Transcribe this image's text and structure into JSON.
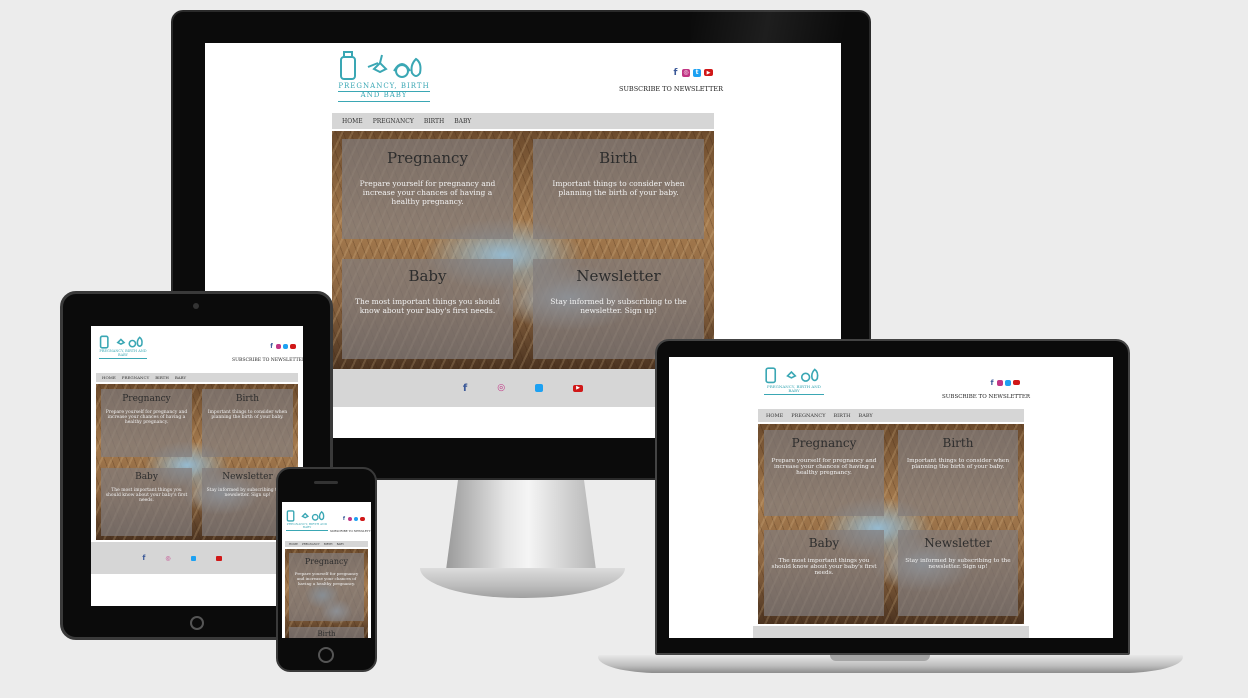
{
  "site": {
    "brand": "Pregnancy, Birth and Baby",
    "brand_line1": "Pregnancy, Birth",
    "brand_line2": "and Baby",
    "subscribe": "SUBSCRIBE TO NEWSLETTER",
    "nav": [
      "HOME",
      "PREGNANCY",
      "BIRTH",
      "BABY"
    ],
    "socials": [
      {
        "name": "facebook",
        "glyph": "f",
        "color": "#3b5998"
      },
      {
        "name": "instagram",
        "glyph": "◎",
        "color": "#c13584"
      },
      {
        "name": "twitter",
        "glyph": "t",
        "color": "#1da1f2"
      },
      {
        "name": "youtube",
        "glyph": "▶",
        "color": "#d01818"
      }
    ],
    "cards": [
      {
        "title": "Pregnancy",
        "desc": "Prepare yourself for pregnancy and increase your chances of having a healthy pregnancy."
      },
      {
        "title": "Birth",
        "desc": "Important things to consider when planning the birth of your baby."
      },
      {
        "title": "Baby",
        "desc": "The most important things you should know about your baby's first needs."
      },
      {
        "title": "Newsletter",
        "desc": "Stay informed by subscribing to the newsletter. Sign up!"
      }
    ],
    "phone_extra_title": "Birth"
  },
  "colors": {
    "brand": "#3aa7b4",
    "nav_bg": "#d6d6d6",
    "device_bezel": "#0b0b0b"
  }
}
